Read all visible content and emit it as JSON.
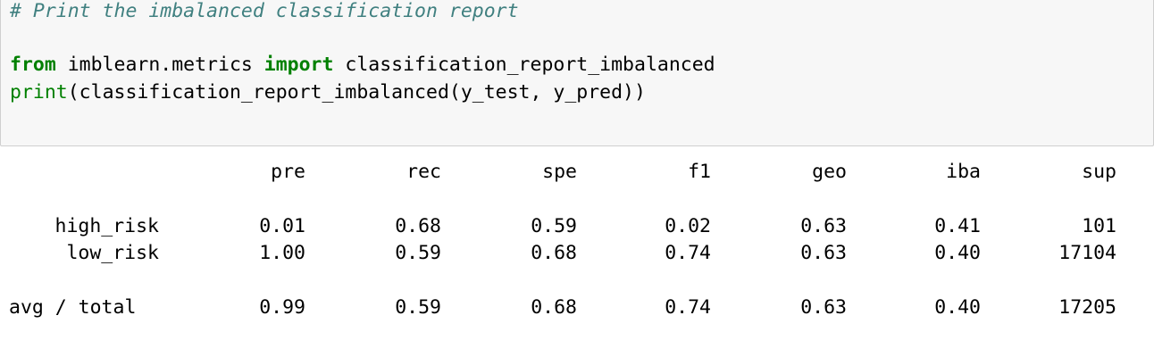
{
  "code": {
    "comment": "# Print the imbalanced classification report",
    "line2": {
      "kw_from": "from",
      "module": " imblearn.metrics ",
      "kw_import": "import",
      "name": " classification_report_imbalanced"
    },
    "line3": {
      "builtin_print": "print",
      "rest": "(classification_report_imbalanced(y_test, y_pred))"
    }
  },
  "report": {
    "columns": [
      "pre",
      "rec",
      "spe",
      "f1",
      "geo",
      "iba",
      "sup"
    ],
    "rows": [
      {
        "label": "high_risk",
        "values": [
          "0.01",
          "0.68",
          "0.59",
          "0.02",
          "0.63",
          "0.41",
          "101"
        ]
      },
      {
        "label": "low_risk",
        "values": [
          "1.00",
          "0.59",
          "0.68",
          "0.74",
          "0.63",
          "0.40",
          "17104"
        ]
      }
    ],
    "total": {
      "label": "avg / total",
      "values": [
        "0.99",
        "0.59",
        "0.68",
        "0.74",
        "0.63",
        "0.40",
        "17205"
      ]
    }
  },
  "colors": {
    "comment": "#408080",
    "keyword": "#008000",
    "cell_background": "#f7f7f7",
    "cell_border": "#cfcfcf"
  }
}
